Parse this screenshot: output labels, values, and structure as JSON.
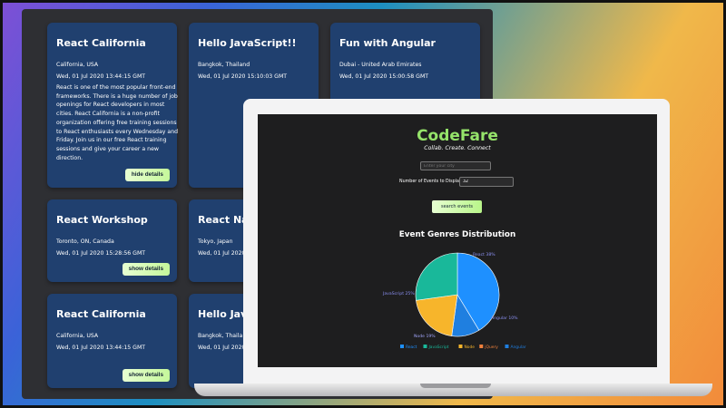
{
  "cards": [
    {
      "title": "React California",
      "location": "California, USA",
      "date": "Wed, 01 Jul 2020 13:44:15 GMT",
      "description": "React is one of the most popular front-end frameworks. There is a huge number of job openings for React developers in most cities. React California is a non-profit organization offering free training sessions to React enthusiasts every Wednesday and Friday. Join us in our free React training sessions and give your career a new direction.",
      "button": "hide details"
    },
    {
      "title": "Hello JavaScript!!",
      "location": "Bangkok, Thailand",
      "date": "Wed, 01 Jul 2020 15:10:03 GMT"
    },
    {
      "title": "Fun with Angular",
      "location": "Dubai - United Arab Emirates",
      "date": "Wed, 01 Jul 2020 15:00:58 GMT"
    },
    {
      "title": "React Workshop",
      "location": "Toronto, ON, Canada",
      "date": "Wed, 01 Jul 2020 15:28:56 GMT",
      "button": "show details"
    },
    {
      "title": "React Nativ",
      "location": "Tokyo, Japan",
      "date": "Wed, 01 Jul 2020"
    },
    {
      "title": "React California",
      "location": "California, USA",
      "date": "Wed, 01 Jul 2020 13:44:15 GMT",
      "button": "show details"
    },
    {
      "title": "Hello JavaS",
      "location": "Bangkok, Thaila",
      "date": "Wed, 01 Jul 2020"
    }
  ],
  "app": {
    "title": "CodeFare",
    "tagline": "Collab. Create. Connect",
    "city_placeholder": "Enter your city",
    "num_label": "Number of Events to Display:",
    "num_value": "32",
    "search_button": "search events",
    "chart_title": "Event Genres Distribution"
  },
  "chart_data": {
    "type": "pie",
    "title": "Event Genres Distribution",
    "series": [
      {
        "name": "React",
        "value": 38,
        "label": "React 38%",
        "color": "#1e90ff"
      },
      {
        "name": "Angular",
        "value": 10,
        "label": "Angular 10%",
        "color": "#1f7fe0"
      },
      {
        "name": "Node",
        "value": 19,
        "label": "Node 19%",
        "color": "#f7b52b"
      },
      {
        "name": "JavaScript",
        "value": 25,
        "label": "JavaScript 25%",
        "color": "#19b89a"
      },
      {
        "name": "jQuery",
        "value": 0,
        "label": "",
        "color": "#f0803c"
      }
    ],
    "legend": [
      "React",
      "JavaScript",
      "Node",
      "jQuery",
      "Angular"
    ],
    "legend_position": "bottom"
  }
}
